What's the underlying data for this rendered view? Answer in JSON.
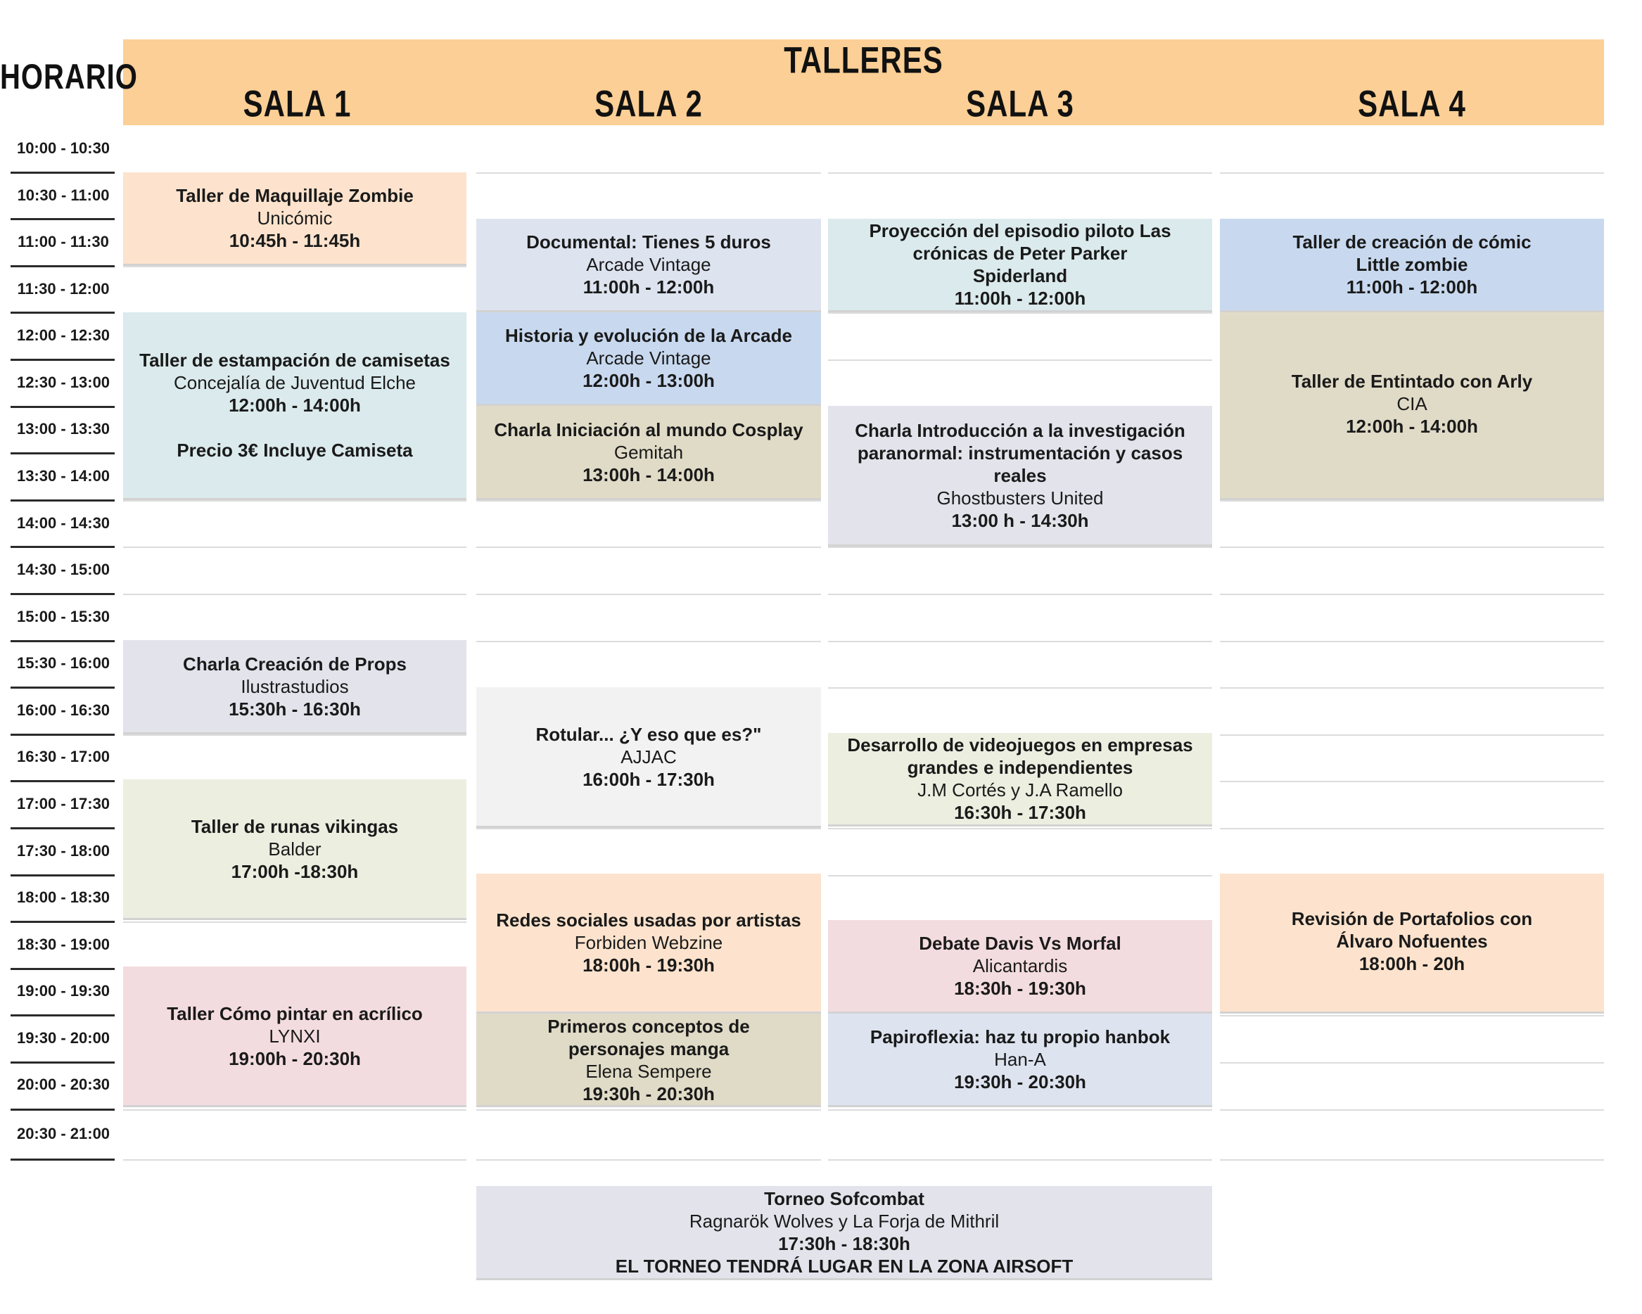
{
  "header": {
    "horario": "HORARIO",
    "talleres": "TALLERES",
    "salas": [
      "SALA 1",
      "SALA 2",
      "SALA 3",
      "SALA 4"
    ]
  },
  "times": [
    "10:00 - 10:30",
    "10:30 - 11:00",
    "11:00 - 11:30",
    "11:30 - 12:00",
    "12:00 - 12:30",
    "12:30 - 13:00",
    "13:00 - 13:30",
    "13:30 - 14:00",
    "14:00 - 14:30",
    "14:30 - 15:00",
    "15:00 - 15:30",
    "15:30 - 16:00",
    "16:00 - 16:30",
    "16:30 - 17:00",
    "17:00 - 17:30",
    "17:30 - 18:00",
    "18:00 - 18:30",
    "18:30 - 19:00",
    "19:00 - 19:30",
    "19:30 - 20:00",
    "20:00 - 20:30",
    "20:30 - 21:00"
  ],
  "sala1": [
    {
      "title": "Taller de Maquillaje Zombie",
      "org": "Unicómic",
      "hours": "10:45h - 11:45h"
    },
    {
      "title": "Taller de estampación de camisetas",
      "org": "Concejalía de Juventud Elche",
      "hours": "12:00h - 14:00h",
      "price": "Precio 3€ Incluye Camiseta"
    },
    {
      "title": "Charla Creación de Props",
      "org": "Ilustrastudios",
      "hours": "15:30h - 16:30h"
    },
    {
      "title": "Taller de runas vikingas",
      "org": "Balder",
      "hours": "17:00h -18:30h"
    },
    {
      "title": "Taller Cómo pintar en acrílico",
      "org": "LYNXI",
      "hours": "19:00h - 20:30h"
    }
  ],
  "sala2": [
    {
      "title": "Documental: Tienes 5 duros",
      "org": "Arcade Vintage",
      "hours": "11:00h - 12:00h"
    },
    {
      "title": "Historia y evolución de la Arcade",
      "org": "Arcade Vintage",
      "hours": "12:00h - 13:00h"
    },
    {
      "title": "Charla Iniciación al mundo Cosplay",
      "org": "Gemitah",
      "hours": "13:00h - 14:00h"
    },
    {
      "title": "Rotular... ¿Y eso que es?\"",
      "org": "AJJAC",
      "hours": "16:00h - 17:30h"
    },
    {
      "title": "Redes sociales usadas por artistas",
      "org": "Forbiden Webzine",
      "hours": "18:00h - 19:30h"
    },
    {
      "title": "Primeros conceptos de personajes manga",
      "org": "Elena Sempere",
      "hours": "19:30h - 20:30h"
    }
  ],
  "sala3": [
    {
      "title": "Proyección del episodio piloto Las crónicas de Peter Parker",
      "org": "Spiderland",
      "hours": "11:00h - 12:00h"
    },
    {
      "title": "Charla Introducción a la investigación paranormal: instrumentación y casos reales",
      "org": "Ghostbusters United",
      "hours": "13:00 h - 14:30h"
    },
    {
      "title": "Desarrollo de videojuegos en empresas grandes e independientes",
      "org": "J.M Cortés y J.A Ramello",
      "hours": "16:30h - 17:30h"
    },
    {
      "title": "Debate Davis Vs Morfal",
      "org": "Alicantardis",
      "hours": "18:30h - 19:30h"
    },
    {
      "title": "Papiroflexia: haz tu propio hanbok",
      "org": "Han-A",
      "hours": "19:30h - 20:30h"
    }
  ],
  "sala4": [
    {
      "title": "Taller de creación de cómic",
      "org": "Little zombie",
      "hours": "11:00h - 12:00h"
    },
    {
      "title": "Taller de Entintado con Arly",
      "org": "CIA",
      "hours": "12:00h - 14:00h"
    },
    {
      "title": "Revisión de Portafolios con Álvaro Nofuentes",
      "hours": "18:00h - 20h"
    }
  ],
  "torneo": {
    "title": "Torneo Sofcombat",
    "org": "Ragnarök Wolves y La Forja de Mithril",
    "hours": "17:30h - 18:30h",
    "note": "EL TORNEO TENDRÁ LUGAR EN LA ZONA AIRSOFT"
  }
}
